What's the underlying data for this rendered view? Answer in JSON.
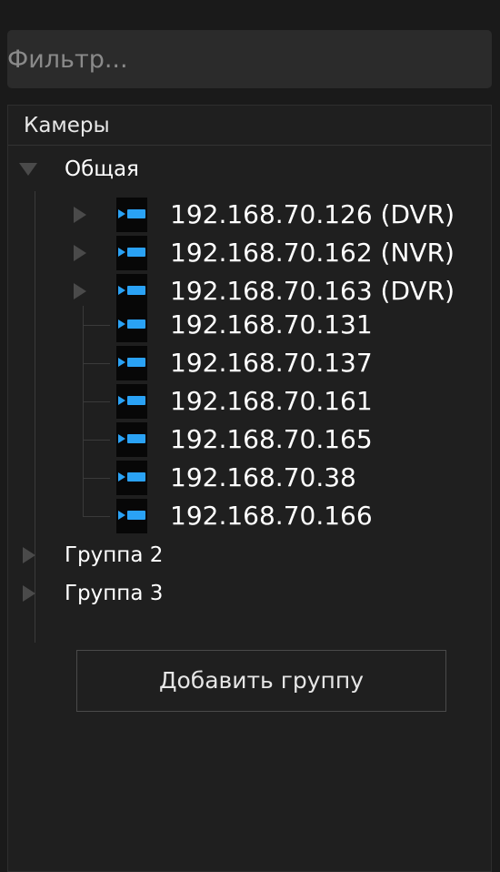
{
  "filter": {
    "placeholder": "Фильтр..."
  },
  "tree": {
    "header": "Камеры",
    "groups": [
      {
        "label": "Общая",
        "expanded": true,
        "devices": [
          {
            "label": "192.168.70.126 (DVR)",
            "expandable": true
          },
          {
            "label": "192.168.70.162 (NVR)",
            "expandable": true
          },
          {
            "label": "192.168.70.163 (DVR)",
            "expandable": true
          },
          {
            "label": "192.168.70.131",
            "expandable": false
          },
          {
            "label": "192.168.70.137",
            "expandable": false
          },
          {
            "label": "192.168.70.161",
            "expandable": false
          },
          {
            "label": "192.168.70.165",
            "expandable": false
          },
          {
            "label": "192.168.70.38",
            "expandable": false
          },
          {
            "label": "192.168.70.166",
            "expandable": false
          }
        ]
      },
      {
        "label": "Группа 2",
        "expanded": false
      },
      {
        "label": "Группа 3",
        "expanded": false
      }
    ]
  },
  "add_group_button": {
    "label": "Добавить группу"
  },
  "colors": {
    "background": "#1a1a1a",
    "accent_camera": "#2aa2f5",
    "text": "#ffffff"
  }
}
